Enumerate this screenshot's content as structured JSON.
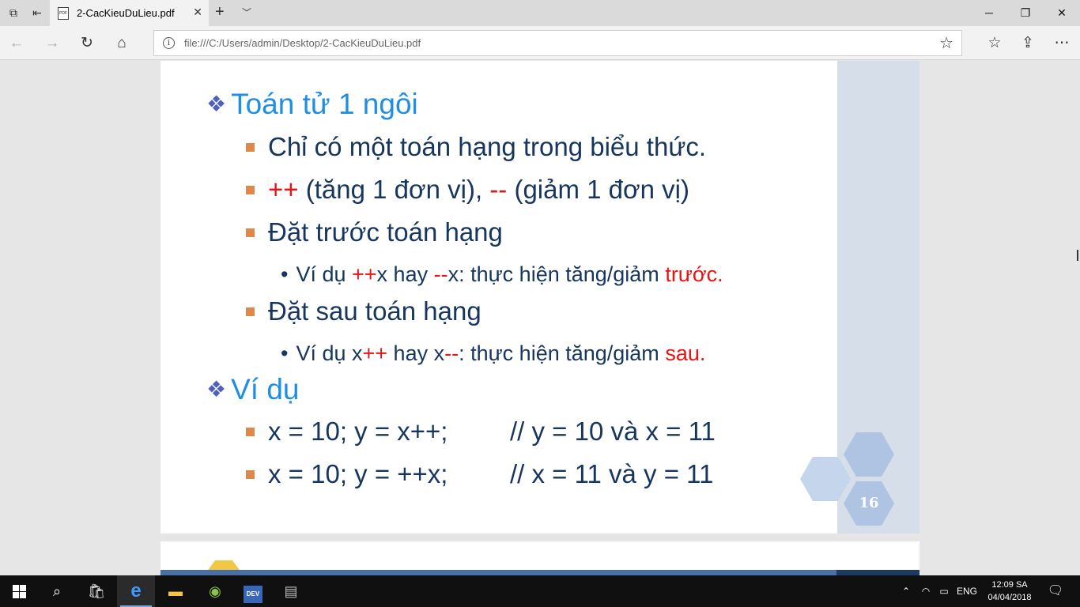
{
  "browser": {
    "tab": {
      "title": "2-CacKieuDuLieu.pdf",
      "icon": "pdf-file-icon"
    },
    "address": {
      "url": "file:///C:/Users/admin/Desktop/2-CacKieuDuLieu.pdf"
    }
  },
  "slide": {
    "heading1": "Toán tử 1 ngôi",
    "b1": "Chỉ có một toán hạng trong biểu thức.",
    "b2": {
      "op1": "++",
      "t1": " (tăng 1 đơn vị), ",
      "op2": "--",
      "t2": " (giảm 1 đơn vị)"
    },
    "b3": "Đặt trước toán hạng",
    "b3sub": {
      "t1": "Ví dụ ",
      "op1": "++",
      "t2": "x hay ",
      "op2": "--",
      "t3": "x: thực hiện tăng/giảm ",
      "hl": "trước."
    },
    "b4": "Đặt sau toán hạng",
    "b4sub": {
      "t1": "Ví dụ x",
      "op1": "++",
      "t2": " hay x",
      "op2": "--",
      "t3": ": thực hiện tăng/giảm ",
      "hl": "sau."
    },
    "heading2": "Ví dụ",
    "ex1": {
      "code": "x = 10; y = x++;",
      "comment": "// y = 10 và x = 11"
    },
    "ex2": {
      "code": "x = 10; y = ++x;",
      "comment": "// x = 11 và y = 11"
    },
    "page_number": "16"
  },
  "taskbar": {
    "language": "ENG",
    "time": "12:09 SA",
    "date": "04/04/2018"
  }
}
